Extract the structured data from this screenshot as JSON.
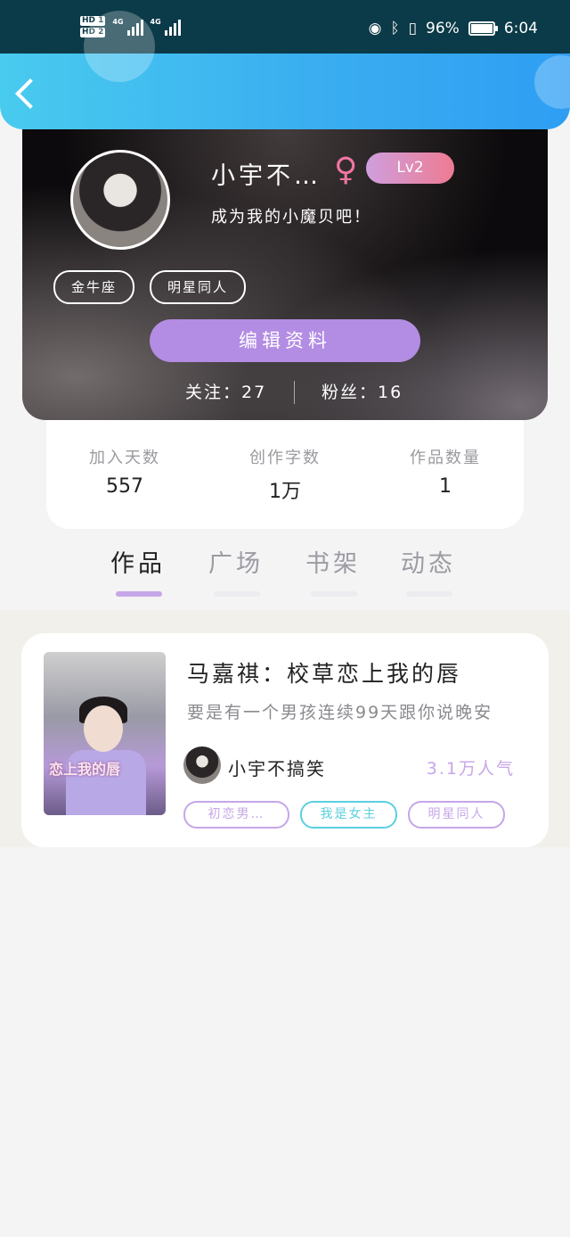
{
  "status_bar": {
    "hd1": "HD 1",
    "hd2": "HD 2",
    "net1": "4G",
    "net2": "4G",
    "bluetooth_icon": "bluetooth-icon",
    "eye_icon": "eye-icon",
    "battery_percent": "96%",
    "time": "6:04"
  },
  "header": {
    "back_icon": "chevron-left-icon",
    "accent_from": "#49cbef",
    "accent_to": "#2e9ef3"
  },
  "profile": {
    "username": "小宇不…",
    "gender_symbol": "♀",
    "level": "Lv2",
    "bio": "成为我的小魔贝吧！",
    "tags": [
      "金牛座",
      "明星同人"
    ],
    "edit_button": "编辑资料",
    "following": "关注：27",
    "fans": "粉丝：16"
  },
  "stats": [
    {
      "label": "加入天数",
      "value": "557"
    },
    {
      "label": "创作字数",
      "value": "1万"
    },
    {
      "label": "作品数量",
      "value": "1"
    }
  ],
  "tabs": [
    {
      "label": "作品",
      "active": true
    },
    {
      "label": "广场",
      "active": false
    },
    {
      "label": "书架",
      "active": false
    },
    {
      "label": "动态",
      "active": false
    }
  ],
  "work": {
    "title": "马嘉祺：校草恋上我的唇",
    "description": "要是有一个男孩连续99天跟你说晚安",
    "cover_text": "恋上我的唇",
    "author": "小宇不搞笑",
    "popularity": "3.1万人气",
    "tags": [
      {
        "label": "初恋男…",
        "color": "#c6a6e8"
      },
      {
        "label": "我是女主",
        "color": "#5ccfdf"
      },
      {
        "label": "明星同人",
        "color": "#c6a6e8"
      }
    ]
  }
}
